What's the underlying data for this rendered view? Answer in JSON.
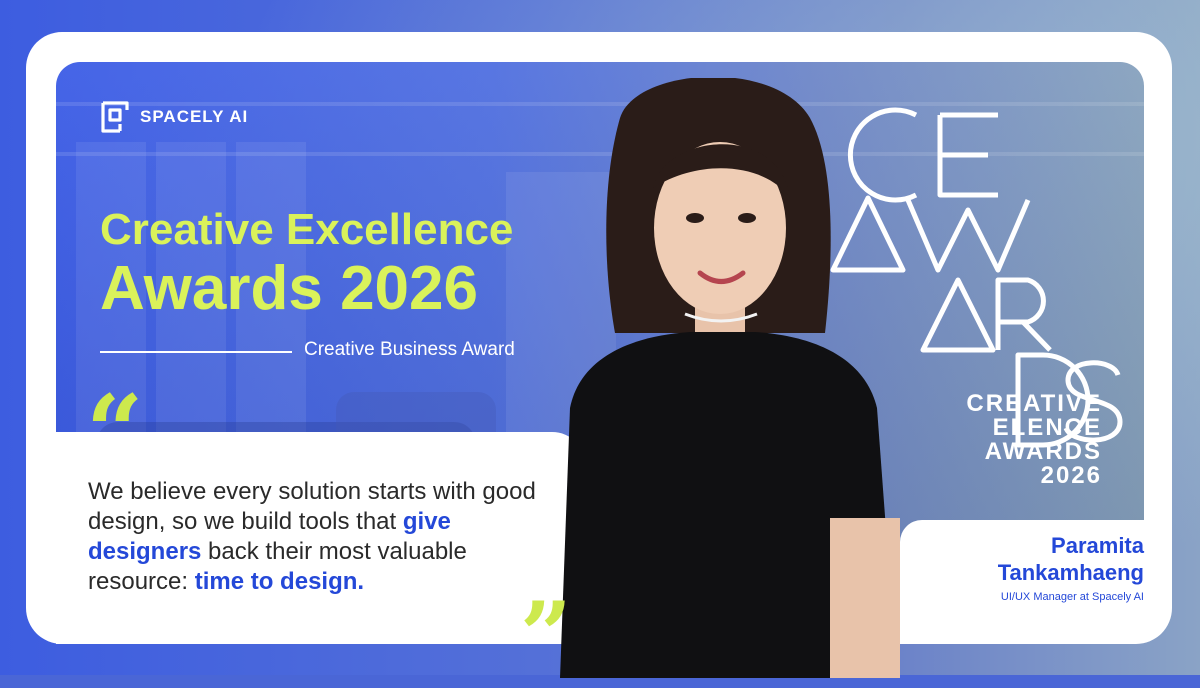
{
  "brand": {
    "name": "SPACELY AI"
  },
  "headline": {
    "line1": "Creative Excellence",
    "line2": "Awards 2026",
    "award": "Creative Business Award"
  },
  "quote": {
    "part1": "We believe every solution starts with good design, so we build tools that ",
    "highlight1": "give designers",
    "part2": " back their most valuable resource: ",
    "highlight2": "time to design."
  },
  "ce_awards": {
    "line1": "CREATIVE",
    "line2": "ELENCE",
    "line3": "AWARDS",
    "year": "2026"
  },
  "person": {
    "name_line1": "Paramita",
    "name_line2": "Tankamhaeng",
    "role": "UI/UX Manager at Spacely AI"
  },
  "colors": {
    "accent_lime": "#daf25a",
    "brand_blue": "#2448d8",
    "bg_blue": "#3a5be6"
  },
  "icons": {
    "logo": "spacely-logo-icon",
    "quote_open": "quote-open-icon",
    "quote_close": "quote-close-icon"
  }
}
